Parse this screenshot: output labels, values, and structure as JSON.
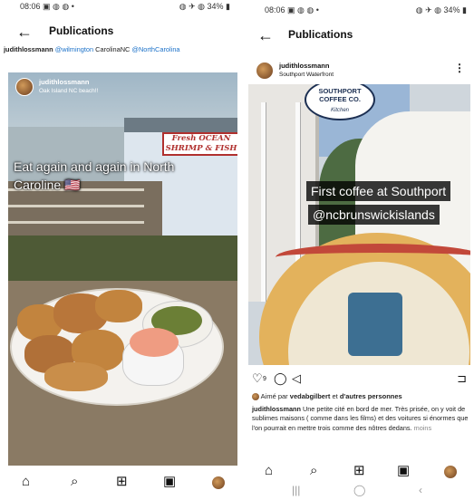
{
  "left": {
    "status": {
      "time": "08:06 ▣ ◍ ◍ •",
      "right": "◍ ✈ ◍ 34% ▮"
    },
    "title": "Publications",
    "caption_user": "judithlossmann",
    "caption_links": [
      "@wilmington",
      "CarolinaNC",
      "@NorthCarolina"
    ],
    "post": {
      "username": "judithlossmann",
      "location": "Oak Island NC beach!!",
      "overlay_text": "Eat again and again in North Caroline 🇺🇸",
      "sign_text": [
        "Fresh OCEAN",
        "SHRIMP & FISH"
      ]
    },
    "nav_icons": [
      "home-icon",
      "search-icon",
      "create-icon",
      "reels-icon",
      "profile-avatar"
    ]
  },
  "right": {
    "status": {
      "time": "08:06 ▣ ◍ ◍ •",
      "right": "◍ ✈ ◍ 34% ▮"
    },
    "title": "Publications",
    "post": {
      "username": "judithlossmann",
      "location": "Southport Waterfront",
      "sign_lines": [
        "SOUTHPORT",
        "COFFEE CO.",
        "Kitchen"
      ],
      "overlay_line1": "First coffee at Southport",
      "overlay_line2": "@ncbrunswickislands"
    },
    "actions": {
      "heart": "♡",
      "like_count": "9",
      "comment": "◯",
      "share": "◁",
      "save": "⊐"
    },
    "likes": {
      "prefix": "Aimé par",
      "user": "vedabgilbert",
      "middle": "et",
      "suffix": "d'autres personnes"
    },
    "caption": {
      "user": "judithlossmann",
      "text": "Une petite cité en bord de mer. Très prisée, on y voit de sublimes maisons ( comme dans les films) et des voitures si énormes que l'on pourrait en mettre trois comme des nôtres dedans.",
      "more": "moins"
    },
    "nav_icons": [
      "home-icon",
      "search-icon",
      "create-icon",
      "reels-icon",
      "profile-avatar"
    ],
    "sys_nav": [
      "|||",
      "◯",
      "‹"
    ]
  }
}
